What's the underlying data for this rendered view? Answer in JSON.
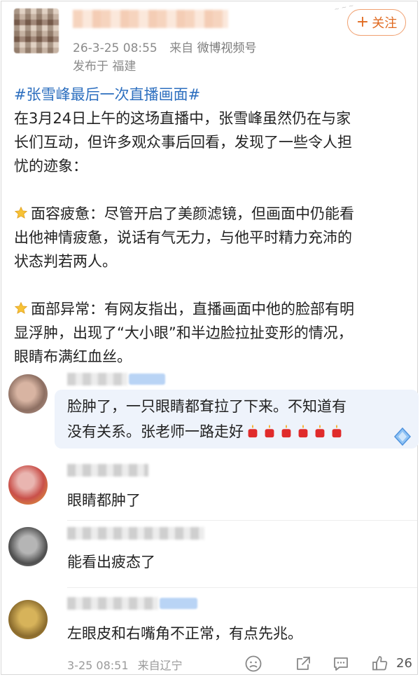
{
  "header": {
    "time": "26-3-25 08:55",
    "source_prefix": "来自",
    "source": "微博视频号",
    "location": "发布于 福建",
    "follow_label": "关注"
  },
  "post": {
    "hashtag": "#张雪峰最后一次直播画面#",
    "intro": "在3月24日上午的这场直播中，张雪峰虽然仍在与家长们互动，但许多观众事后回看，发现了一些令人担忧的迹象：",
    "point1_lines": [
      "面容疲惫：尽管开启了美颜滤镜，但画面中仍能看",
      "出他神情疲惫，说话有气无力，与他平时精力充沛的",
      "状态判若两人。"
    ],
    "point2_lines": [
      "面部异常：有网友指出，直播画面中他的脸部有明",
      "显浮肿，出现了“大小眼”和半边脸拉扯变形的情况，",
      "眼睛布满红血丝。"
    ],
    "intro_lines": [
      "在3月24日上午的这场直播中，张雪峰虽然仍在与家",
      "长们互动，但许多观众事后回看，发现了一些令人担",
      "忧的迹象："
    ]
  },
  "comments": [
    {
      "text_lines": [
        "脸肿了，一只眼睛都耷拉了下来。不知道有",
        "没有关系。张老师一路走好"
      ]
    },
    {
      "text_lines": [
        "眼睛都肿了"
      ]
    },
    {
      "text_lines": [
        "能看出疲态了"
      ]
    },
    {
      "text_lines": [
        "左眼皮和右嘴角不正常，有点先兆。"
      ]
    }
  ],
  "footer": {
    "time": "3-25 08:51",
    "location": "来自辽宁",
    "like_count": "26"
  },
  "icons": [
    "star-icon",
    "candle-icon",
    "diamond-badge-icon",
    "emoji-icon",
    "share-icon",
    "comment-icon",
    "like-icon"
  ],
  "colors": {
    "hashtag": "#2d6fbf",
    "follow": "#e06a20",
    "bubble": "#eef3fb"
  }
}
